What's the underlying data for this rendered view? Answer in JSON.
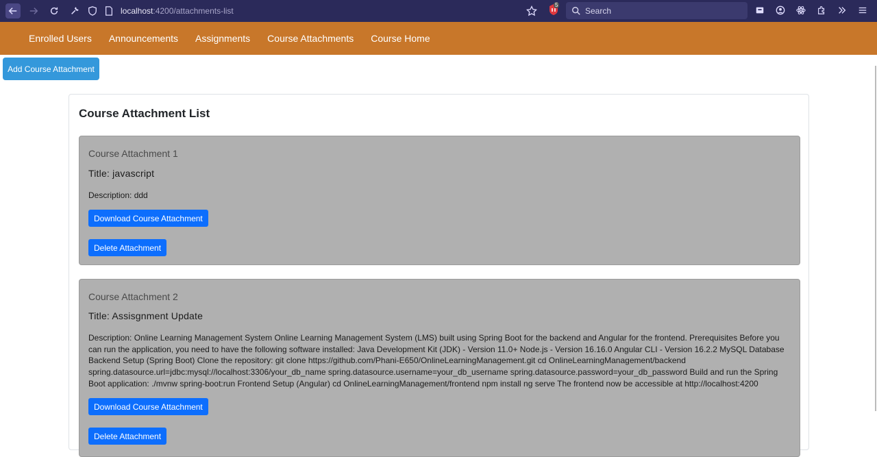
{
  "browser": {
    "url_host": "localhost",
    "url_path": ":4200/attachments-list",
    "search_label": "Search",
    "extension_badge": "5"
  },
  "nav": {
    "items": [
      "Enrolled Users",
      "Announcements",
      "Assignments",
      "Course Attachments",
      "Course Home"
    ]
  },
  "toolbar": {
    "add_label": "Add Course Attachment"
  },
  "list": {
    "title": "Course Attachment List",
    "items": [
      {
        "heading": "Course Attachment 1",
        "title": "Title: javascript",
        "description": "Description: ddd",
        "download_label": "Download Course Attachment",
        "delete_label": "Delete Attachment"
      },
      {
        "heading": "Course Attachment 2",
        "title": "Title: Assisgnment Update",
        "description": "Description: Online Learning Management System  Online Learning Management System (LMS) built using Spring Boot for the backend and Angular for the frontend. Prerequisites  Before you can run the application, you need to have the following software installed:  Java Development Kit (JDK) - Version 11.0+ Node.js - Version 16.16.0 Angular CLI - Version 16.2.2 MySQL Database  Backend Setup (Spring Boot)  Clone the repository:  git clone https://github.com/Phani-E650/OnlineLearningManagement.git  cd OnlineLearningManagement/backend  spring.datasource.url=jdbc:mysql://localhost:3306/your_db_name  spring.datasource.username=your_db_username  spring.datasource.password=your_db_password  Build and run the Spring Boot application: ./mvnw spring-boot:run Frontend Setup (Angular)  cd OnlineLearningManagement/frontend  npm install  ng serve  The frontend now be accessible at http://localhost:4200",
        "download_label": "Download Course Attachment",
        "delete_label": "Delete Attachment"
      }
    ]
  }
}
